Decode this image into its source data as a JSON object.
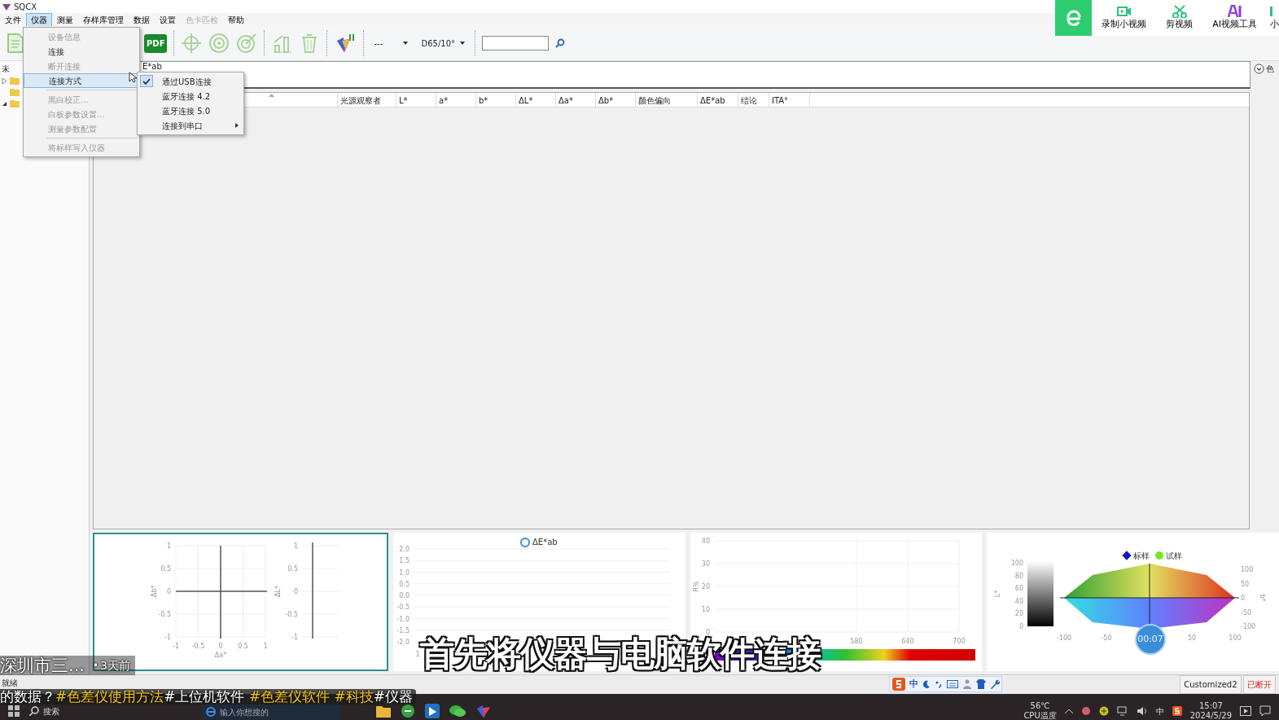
{
  "window": {
    "title": "SQCX"
  },
  "menu_bar": [
    {
      "label": "文件",
      "selected": false,
      "disabled": false
    },
    {
      "label": "仪器",
      "selected": true,
      "disabled": false
    },
    {
      "label": "测量",
      "selected": false,
      "disabled": false
    },
    {
      "label": "存样库管理",
      "selected": false,
      "disabled": false
    },
    {
      "label": "数据",
      "selected": false,
      "disabled": false
    },
    {
      "label": "设置",
      "selected": false,
      "disabled": false
    },
    {
      "label": "色卡匹检",
      "selected": false,
      "disabled": true
    },
    {
      "label": "帮助",
      "selected": false,
      "disabled": false
    }
  ],
  "instrument_menu": [
    {
      "kind": "item",
      "label": "设备信息",
      "disabled": true,
      "selected": false,
      "has_submenu": false
    },
    {
      "kind": "item",
      "label": "连接",
      "disabled": false,
      "selected": false,
      "has_submenu": false
    },
    {
      "kind": "item",
      "label": "断开连接",
      "disabled": true,
      "selected": false,
      "has_submenu": false
    },
    {
      "kind": "item",
      "label": "连接方式",
      "disabled": false,
      "selected": true,
      "has_submenu": true
    },
    {
      "kind": "separator"
    },
    {
      "kind": "item",
      "label": "黑白校正...",
      "disabled": true,
      "selected": false,
      "has_submenu": false
    },
    {
      "kind": "item",
      "label": "白板参数设置...",
      "disabled": true,
      "selected": false,
      "has_submenu": false
    },
    {
      "kind": "item",
      "label": "测量参数配置",
      "disabled": true,
      "selected": false,
      "has_submenu": false
    },
    {
      "kind": "separator"
    },
    {
      "kind": "item",
      "label": "将标样写入仪器",
      "disabled": true,
      "selected": false,
      "has_submenu": false
    }
  ],
  "connection_submenu": [
    {
      "label": "通过USB连接",
      "checked": true,
      "has_submenu": false
    },
    {
      "label": "蓝牙连接 4.2",
      "checked": false,
      "has_submenu": false
    },
    {
      "label": "蓝牙连接 5.0",
      "checked": false,
      "has_submenu": false
    },
    {
      "label": "连接到串口",
      "checked": false,
      "has_submenu": true
    }
  ],
  "toolbar": {
    "pdf": "PDF",
    "light_source": "---",
    "illuminant": "D65/10°"
  },
  "tree": {
    "header": "未",
    "nodes": [
      {
        "expanded": false,
        "has_children": true
      },
      {
        "has_children": false
      },
      {
        "expanded": true,
        "has_children": true
      }
    ]
  },
  "results_tab": "E*ab",
  "color_combo": "色",
  "table": {
    "columns": [
      {
        "label": "光源观察者"
      },
      {
        "label": "L*"
      },
      {
        "label": "a*"
      },
      {
        "label": "b*"
      },
      {
        "label": "ΔL*"
      },
      {
        "label": "Δa*"
      },
      {
        "label": "Δb*"
      },
      {
        "label": "颜色偏向"
      },
      {
        "label": "ΔE*ab"
      },
      {
        "label": "结论"
      },
      {
        "label": "ITA°"
      }
    ]
  },
  "charts": [
    {
      "kind": "delta_ab",
      "x_label": "Δa*",
      "y_label": "Δb*",
      "x_ticks": [
        "-1",
        "-0.5",
        "0",
        "0.5",
        "1"
      ],
      "y_ticks": [
        "1",
        "0.5",
        "0",
        "-0.5",
        "-1"
      ],
      "side_label": "ΔL*",
      "side_ticks": [
        "1",
        "0.5",
        "0",
        "-0.5",
        "-1"
      ]
    },
    {
      "kind": "trend",
      "legend": "ΔE*ab",
      "y_ticks": [
        "2.0",
        "1.5",
        "1.0",
        "0.5",
        "0.0",
        "-0.5",
        "-1.0",
        "-1.5",
        "-2.0"
      ],
      "x_ticks": [
        "1"
      ]
    },
    {
      "kind": "spectrum",
      "y_label": "R%",
      "y_ticks": [
        "40",
        "30",
        "20",
        "10",
        "0"
      ],
      "x_ticks": [
        "580",
        "640",
        "700"
      ]
    },
    {
      "kind": "gamut",
      "lightness_label": "L*",
      "lightness_ticks": [
        "100",
        "80",
        "60",
        "40",
        "20",
        "0"
      ],
      "x_ticks": [
        "-100",
        "-50",
        "50",
        "100"
      ],
      "y_label": "b*",
      "y_ticks": [
        "100",
        "50",
        "0",
        "-50",
        "-100"
      ],
      "legend": [
        {
          "name": "标样",
          "color": "#1414c8"
        },
        {
          "name": "试样",
          "color": "#78e628"
        }
      ]
    }
  ],
  "status_bar": {
    "text": "就绪",
    "profile": "Customized2",
    "connection": "已断开"
  },
  "ime_bar": {
    "language": "中"
  },
  "taskbar": {
    "search": "搜索",
    "browser_search": "输入你想搜的",
    "temperature": "56℃",
    "temperature_label": "CPU温度",
    "tray_ime": "中",
    "time": "15:07",
    "date": "2024/5/29"
  },
  "video_overlay": {
    "tools": [
      {
        "label": "录制小视频",
        "kind": "record"
      },
      {
        "label": "剪视频",
        "kind": "cut"
      },
      {
        "label": "AI视频工具",
        "kind": "ai"
      },
      {
        "label": "小",
        "kind": "partial"
      }
    ],
    "subtitle": "首先将仪器与电脑软件连接",
    "author": "深圳市三...",
    "dot": "·",
    "posted": "3天前",
    "timer": "00:07",
    "caption": [
      {
        "text": "的数据？",
        "highlighted": false
      },
      {
        "text": "#色差仪使用方法",
        "highlighted": true
      },
      {
        "text": "#上位机软件 ",
        "highlighted": false
      },
      {
        "text": "#色差仪软件 ",
        "highlighted": true
      },
      {
        "text": " #科技",
        "highlighted": true
      },
      {
        "text": "#仪器",
        "highlighted": false
      }
    ]
  }
}
